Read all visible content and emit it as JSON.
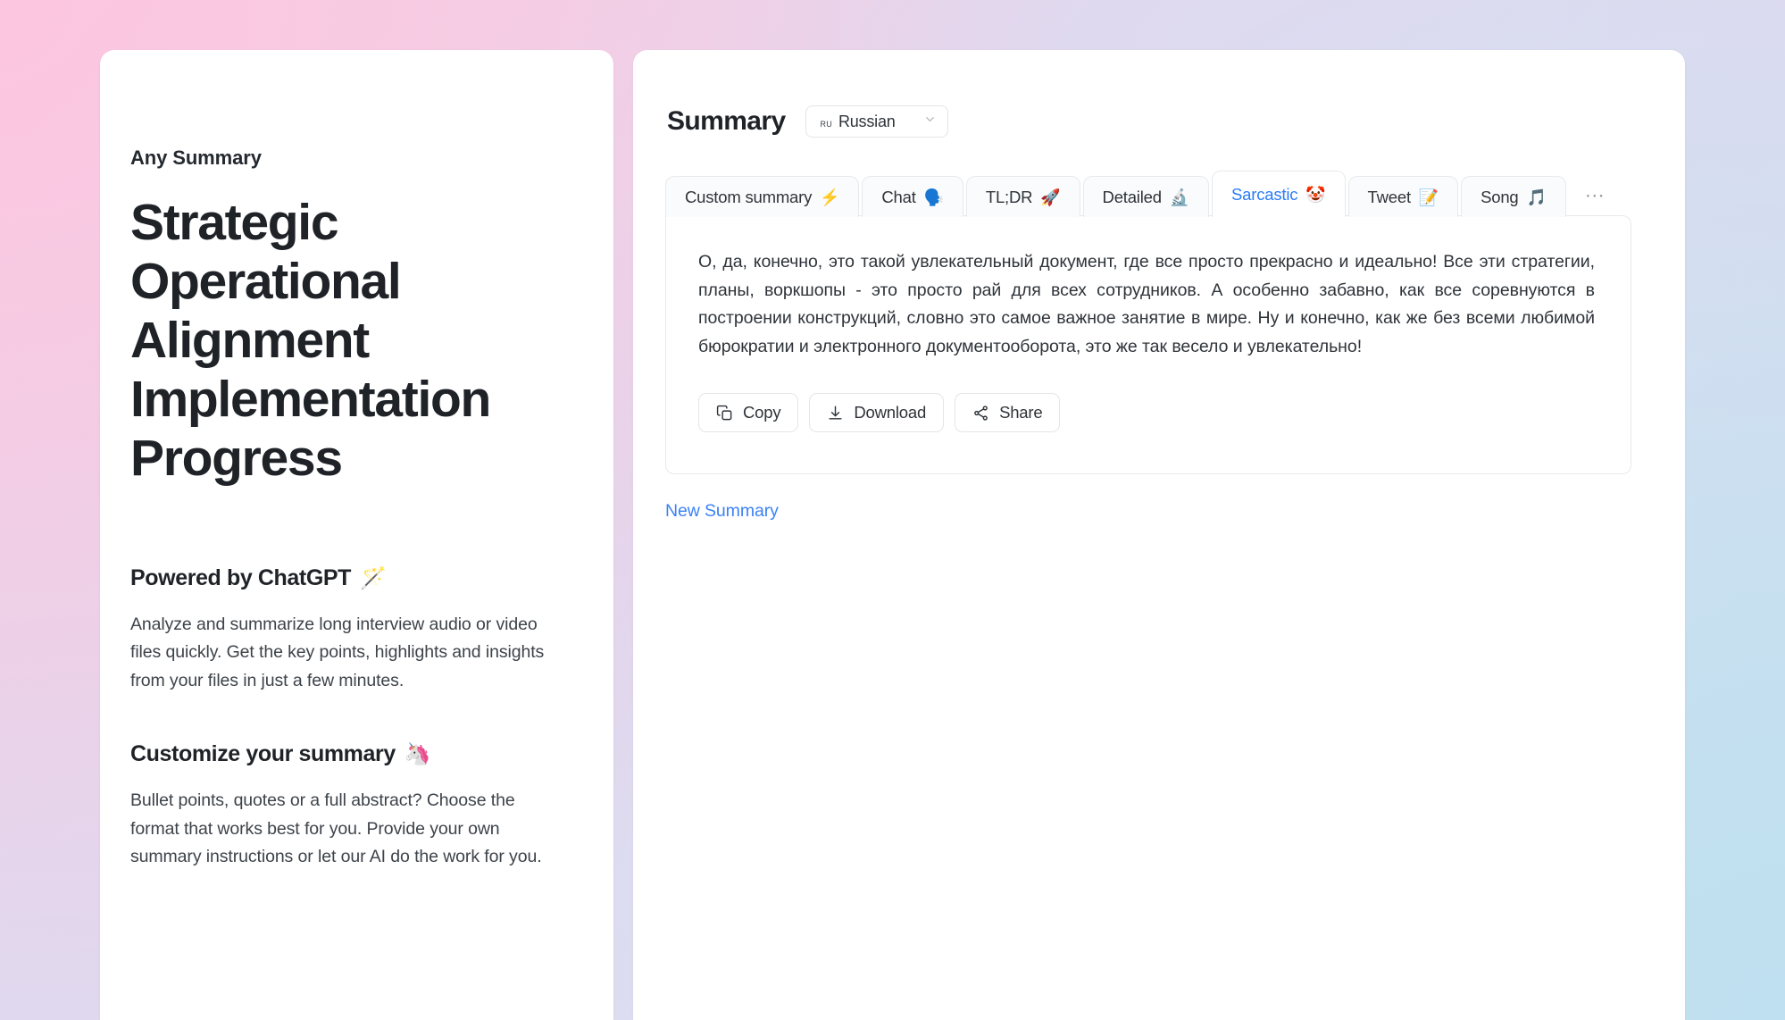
{
  "left": {
    "brand": "Any Summary",
    "doc_title": "Strategic Operational Alignment Implementation Progress",
    "features": [
      {
        "heading": "Powered by ChatGPT",
        "emoji": "🪄",
        "emoji_name": "magic-wand-emoji",
        "body": "Analyze and summarize long interview audio or video files quickly. Get the key points, highlights and insights from your files in just a few minutes."
      },
      {
        "heading": "Customize your summary",
        "emoji": "🦄",
        "emoji_name": "unicorn-emoji",
        "body": "Bullet points, quotes or a full abstract? Choose the format that works best for you. Provide your own summary instructions or let our AI do the work for you."
      }
    ]
  },
  "right": {
    "title": "Summary",
    "language": {
      "code": "ru",
      "name": "Russian"
    },
    "tabs": [
      {
        "label": "Custom summary",
        "emoji": "⚡",
        "emoji_name": "lightning-bolt-emoji",
        "active": false
      },
      {
        "label": "Chat",
        "emoji": "🗣️",
        "emoji_name": "speaking-head-emoji",
        "active": false
      },
      {
        "label": "TL;DR",
        "emoji": "🚀",
        "emoji_name": "rocket-emoji",
        "active": false
      },
      {
        "label": "Detailed",
        "emoji": "🔬",
        "emoji_name": "microscope-emoji",
        "active": false
      },
      {
        "label": "Sarcastic",
        "emoji": "🤡",
        "emoji_name": "clown-face-emoji",
        "active": true
      },
      {
        "label": "Tweet",
        "emoji": "📝",
        "emoji_name": "memo-emoji",
        "active": false
      },
      {
        "label": "Song",
        "emoji": "🎵",
        "emoji_name": "musical-note-emoji",
        "active": false
      }
    ],
    "more_tabs_label": "⋯",
    "summary_text": "О, да, конечно, это такой увлекательный документ, где все просто прекрасно и идеально! Все эти стратегии, планы, воркшопы - это просто рай для всех сотрудников. А особенно забавно, как все соревнуются в построении конструкций, словно это самое важное занятие в мире. Ну и конечно, как же без всеми любимой бюрократии и электронного документооборота, это же так весело и увлекательно!",
    "actions": [
      {
        "label": "Copy",
        "icon": "copy-icon"
      },
      {
        "label": "Download",
        "icon": "download-icon"
      },
      {
        "label": "Share",
        "icon": "share-icon"
      }
    ],
    "new_summary_label": "New Summary"
  },
  "colors": {
    "accent_blue": "#2a7bf6",
    "link_blue": "#3b82f6",
    "text_primary": "#1f2328",
    "text_secondary": "#3d434a",
    "border": "#e7e9ec",
    "panel_bg": "#ffffff"
  }
}
